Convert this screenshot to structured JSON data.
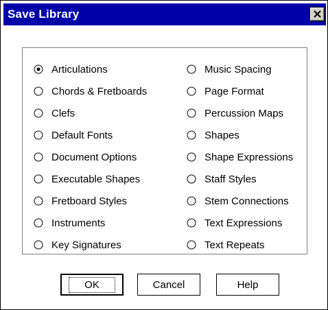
{
  "window": {
    "title": "Save Library",
    "close_label": "Close"
  },
  "options": {
    "left": [
      {
        "label": "Articulations",
        "selected": true
      },
      {
        "label": "Chords & Fretboards",
        "selected": false
      },
      {
        "label": "Clefs",
        "selected": false
      },
      {
        "label": "Default Fonts",
        "selected": false
      },
      {
        "label": "Document Options",
        "selected": false
      },
      {
        "label": "Executable Shapes",
        "selected": false
      },
      {
        "label": "Fretboard Styles",
        "selected": false
      },
      {
        "label": "Instruments",
        "selected": false
      },
      {
        "label": "Key Signatures",
        "selected": false
      }
    ],
    "right": [
      {
        "label": "Music Spacing",
        "selected": false
      },
      {
        "label": "Page Format",
        "selected": false
      },
      {
        "label": "Percussion Maps",
        "selected": false
      },
      {
        "label": "Shapes",
        "selected": false
      },
      {
        "label": "Shape Expressions",
        "selected": false
      },
      {
        "label": "Staff Styles",
        "selected": false
      },
      {
        "label": "Stem Connections",
        "selected": false
      },
      {
        "label": "Text Expressions",
        "selected": false
      },
      {
        "label": "Text Repeats",
        "selected": false
      }
    ]
  },
  "buttons": {
    "ok": "OK",
    "cancel": "Cancel",
    "help": "Help"
  }
}
